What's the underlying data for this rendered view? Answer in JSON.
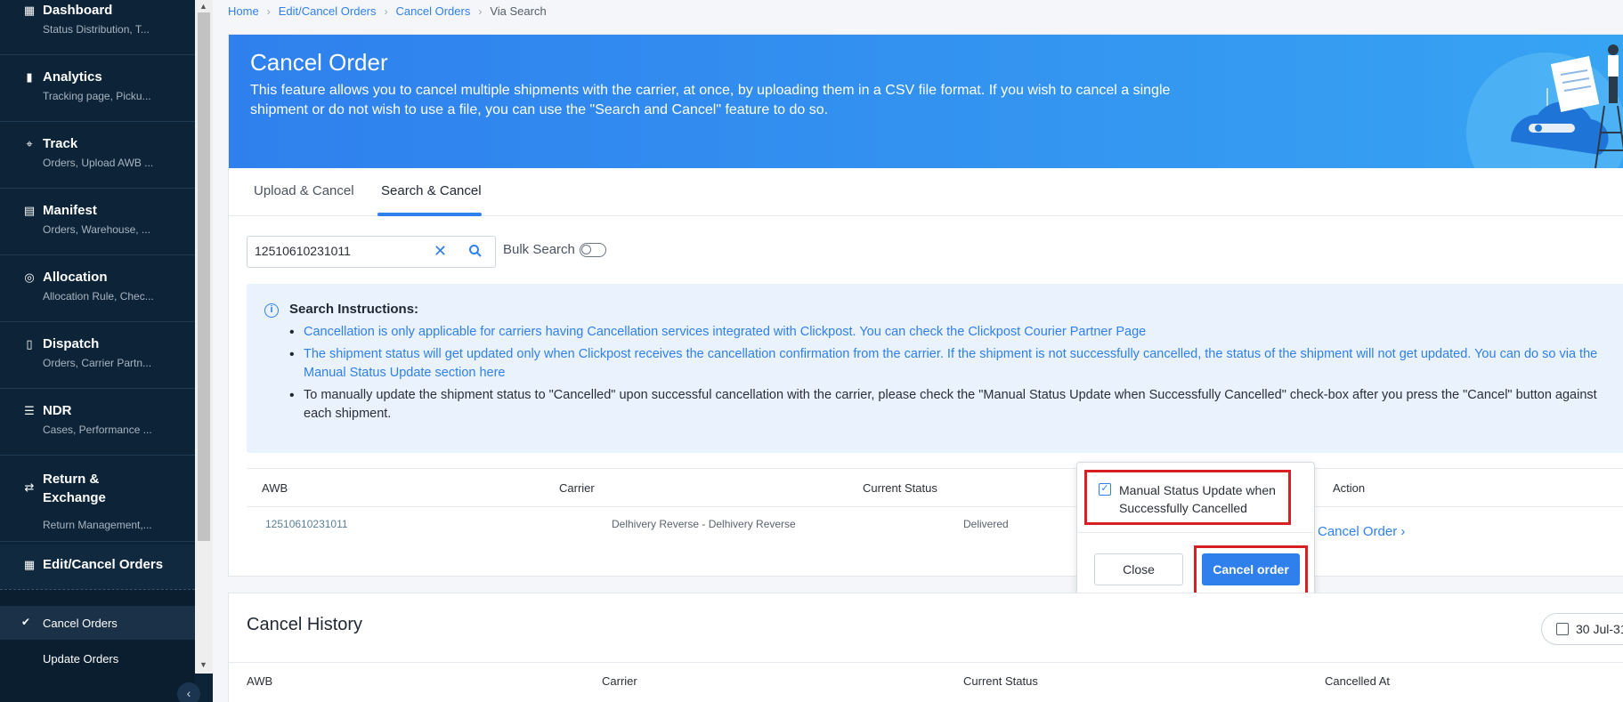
{
  "sidebar": {
    "items": [
      {
        "title": "Dashboard",
        "sub": "Status Distribution, T...",
        "icon": "dashboard-icon"
      },
      {
        "title": "Analytics",
        "sub": "Tracking page, Picku...",
        "icon": "bar-chart-icon"
      },
      {
        "title": "Track",
        "sub": "Orders, Upload AWB ...",
        "icon": "location-pin-icon"
      },
      {
        "title": "Manifest",
        "sub": "Orders, Warehouse, ...",
        "icon": "table-icon"
      },
      {
        "title": "Allocation",
        "sub": "Allocation Rule, Chec...",
        "icon": "target-icon"
      },
      {
        "title": "Dispatch",
        "sub": "Orders, Carrier Partn...",
        "icon": "clipboard-icon"
      },
      {
        "title": "NDR",
        "sub": "Cases, Performance ...",
        "icon": "list-icon"
      },
      {
        "title": "Return & Exchange",
        "sub": "Return Management,...",
        "icon": "exchange-icon"
      },
      {
        "title": "Edit/Cancel Orders",
        "sub": "",
        "icon": "grid-icon"
      }
    ],
    "sub_items": [
      {
        "label": "Cancel Orders",
        "active": true
      },
      {
        "label": "Update Orders",
        "active": false
      }
    ]
  },
  "breadcrumb": [
    "Home",
    "Edit/Cancel Orders",
    "Cancel Orders",
    "Via Search"
  ],
  "banner": {
    "title": "Cancel Order",
    "description": "This feature allows you to cancel multiple shipments with the carrier, at once, by uploading them in a CSV file format. If you wish to cancel a single shipment or do not wish to use a file, you can use the \"Search and Cancel\" feature to do so."
  },
  "tabs": [
    {
      "label": "Upload & Cancel",
      "active": false
    },
    {
      "label": "Search & Cancel",
      "active": true
    }
  ],
  "search": {
    "value": "12510610231011",
    "bulk_label": "Bulk Search",
    "bulk_enabled": false
  },
  "instructions": {
    "title": "Search Instructions:",
    "items": [
      "Cancellation is only applicable for carriers having Cancellation services integrated with Clickpost. You can check the Clickpost Courier Partner Page",
      "The shipment status will get updated only when Clickpost receives the cancellation confirmation from the carrier. If the shipment is not successfully cancelled, the status of the shipment will not get updated. You can do so via the Manual Status Update section here",
      "To manually update the shipment status to \"Cancelled\" upon successful cancellation with the carrier, please check the \"Manual Status Update when Successfully Cancelled\" check-box after you press the \"Cancel\" button against each shipment."
    ]
  },
  "results": {
    "columns": [
      "AWB",
      "Carrier",
      "Current Status",
      "Action"
    ],
    "rows": [
      {
        "awb": "12510610231011",
        "carrier": "Delhivery Reverse - Delhivery Reverse",
        "status": "Delivered",
        "action": "Cancel Order"
      }
    ]
  },
  "popup": {
    "checkbox_label": "Manual Status Update when Successfully Cancelled",
    "checked": true,
    "close_label": "Close",
    "confirm_label": "Cancel order"
  },
  "history": {
    "title": "Cancel History",
    "date_range": "30 Jul-31",
    "columns": [
      "AWB",
      "Carrier",
      "Current Status",
      "Cancelled At"
    ]
  },
  "colors": {
    "accent": "#2f80ed",
    "sidebar": "#0d2438",
    "highlight": "#d81f26"
  }
}
